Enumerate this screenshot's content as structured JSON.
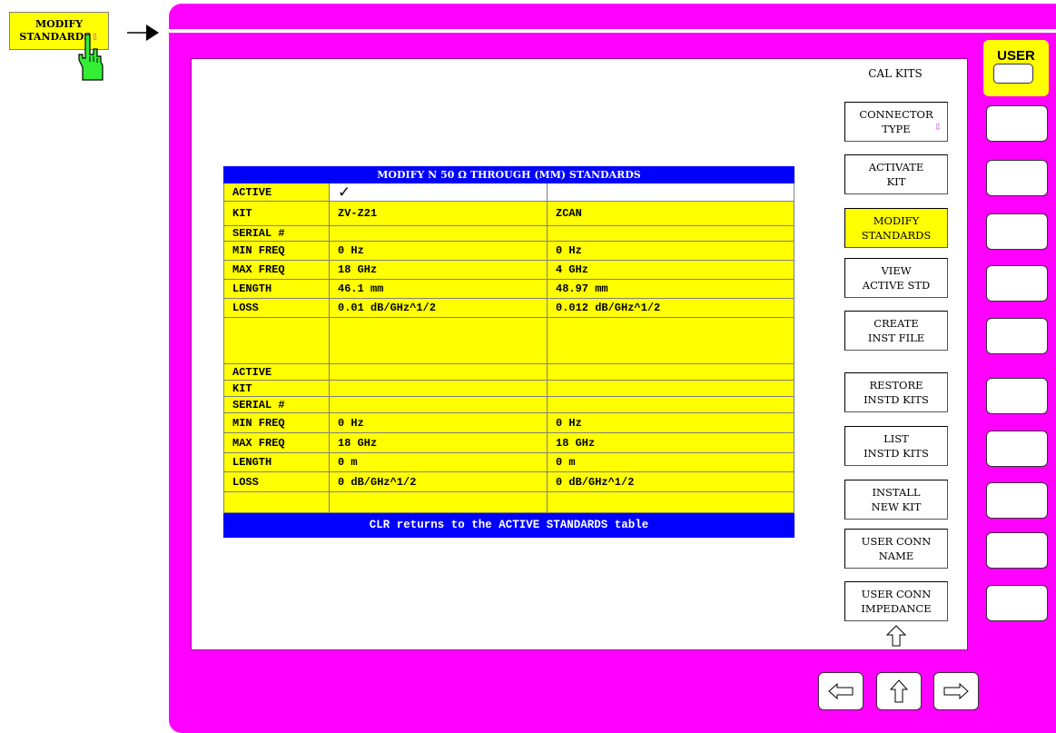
{
  "external_key": {
    "line1": "MODIFY",
    "line2": "STANDARDS",
    "arrow_glyph": "⇩"
  },
  "menu": {
    "title": "CAL KITS",
    "softkeys": [
      {
        "line1": "CONNECTOR",
        "line2": "TYPE",
        "submenu": true,
        "active": false
      },
      {
        "line1": "ACTIVATE",
        "line2": "KIT",
        "submenu": false,
        "active": false
      },
      {
        "line1": "MODIFY",
        "line2": "STANDARDS",
        "submenu": false,
        "active": true
      },
      {
        "line1": "VIEW",
        "line2": "ACTIVE STD",
        "submenu": false,
        "active": false
      },
      {
        "line1": "CREATE",
        "line2": "INST FILE",
        "submenu": false,
        "active": false
      },
      {
        "line1": "RESTORE",
        "line2": "INSTD KITS",
        "submenu": false,
        "active": false
      },
      {
        "line1": "LIST",
        "line2": "INSTD KITS",
        "submenu": false,
        "active": false
      },
      {
        "line1": "INSTALL",
        "line2": "NEW KIT",
        "submenu": false,
        "active": false
      },
      {
        "line1": "USER CONN",
        "line2": "NAME",
        "submenu": false,
        "active": false
      },
      {
        "line1": "USER CONN",
        "line2": "IMPEDANCE",
        "submenu": false,
        "active": false
      }
    ],
    "submenu_glyph": "⇩"
  },
  "table": {
    "title": "MODIFY N 50 Ω THROUGH (MM) STANDARDS",
    "footer": "CLR returns to the ACTIVE STANDARDS table",
    "check_glyph": "✓",
    "block1": [
      [
        "ACTIVE",
        "",
        ""
      ],
      [
        "KIT",
        "ZV-Z21",
        "ZCAN"
      ],
      [
        "SERIAL #",
        "",
        ""
      ],
      [
        "MIN FREQ",
        "0 Hz",
        "0 Hz"
      ],
      [
        "MAX FREQ",
        "18 GHz",
        "4 GHz"
      ],
      [
        "LENGTH",
        "46.1 mm",
        "48.97 mm"
      ],
      [
        "LOSS",
        "0.01 dB/GHz^1/2",
        "0.012 dB/GHz^1/2"
      ]
    ],
    "block2": [
      [
        "ACTIVE",
        "",
        ""
      ],
      [
        "KIT",
        "",
        ""
      ],
      [
        "SERIAL #",
        "",
        ""
      ],
      [
        "MIN FREQ",
        "0 Hz",
        "0 Hz"
      ],
      [
        "MAX FREQ",
        "18 GHz",
        "18 GHz"
      ],
      [
        "LENGTH",
        "0 m",
        "0 m"
      ],
      [
        "LOSS",
        "0 dB/GHz^1/2",
        "0 dB/GHz^1/2"
      ]
    ]
  },
  "hardkeys": {
    "user_label": "USER"
  },
  "colors": {
    "frame": "#ff00ff",
    "table_bg": "#ffff00",
    "table_header": "#0000ff",
    "submenu_arrow": "#cc33cc"
  }
}
